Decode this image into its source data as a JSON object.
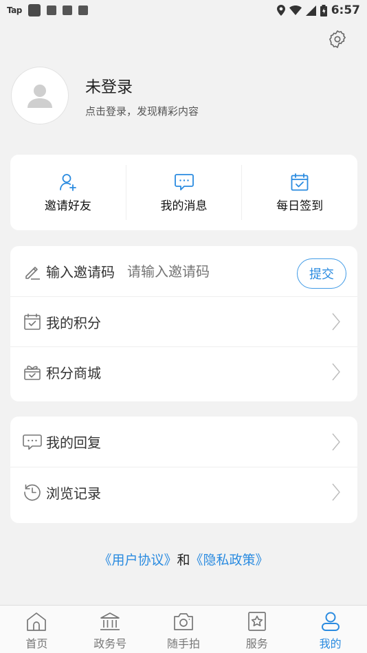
{
  "status_bar": {
    "app_tag": "Tap",
    "time": "6:57"
  },
  "colors": {
    "accent": "#2a8be0",
    "background": "#f2f2f2",
    "card": "#ffffff"
  },
  "profile": {
    "name": "未登录",
    "subtitle": "点击登录，发现精彩内容"
  },
  "quick_actions": [
    {
      "label": "邀请好友",
      "icon": "add-user-icon"
    },
    {
      "label": "我的消息",
      "icon": "message-icon"
    },
    {
      "label": "每日签到",
      "icon": "calendar-check-icon"
    }
  ],
  "invite": {
    "label": "输入邀请码",
    "placeholder": "请输入邀请码",
    "value": "",
    "submit_label": "提交"
  },
  "menu_group1": [
    {
      "label": "我的积分",
      "icon": "calendar-check-icon"
    },
    {
      "label": "积分商城",
      "icon": "gift-icon"
    }
  ],
  "menu_group2": [
    {
      "label": "我的回复",
      "icon": "comment-icon"
    },
    {
      "label": "浏览记录",
      "icon": "history-icon"
    }
  ],
  "agreement": {
    "user_agreement": "《用户协议》",
    "and": "和",
    "privacy_policy": "《隐私政策》"
  },
  "tabs": [
    {
      "label": "首页",
      "icon": "home-icon",
      "active": false
    },
    {
      "label": "政务号",
      "icon": "government-icon",
      "active": false
    },
    {
      "label": "随手拍",
      "icon": "camera-icon",
      "active": false
    },
    {
      "label": "服务",
      "icon": "star-bookmark-icon",
      "active": false
    },
    {
      "label": "我的",
      "icon": "user-icon",
      "active": true
    }
  ]
}
